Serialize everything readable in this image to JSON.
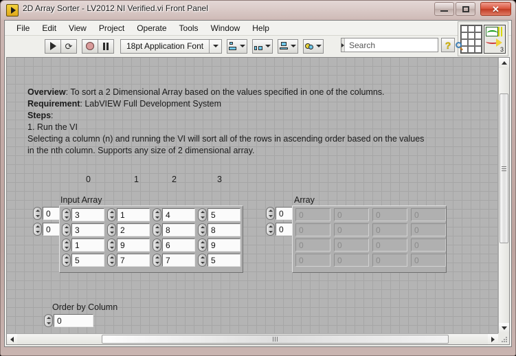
{
  "window": {
    "title": "2D Array Sorter - LV2012 NI Verified.vi Front Panel",
    "icon": "labview-vi-icon",
    "minimize_label": "–",
    "maximize_label": "□",
    "close_label": "✕"
  },
  "menu": {
    "items": [
      {
        "label": "File"
      },
      {
        "label": "Edit"
      },
      {
        "label": "View"
      },
      {
        "label": "Project"
      },
      {
        "label": "Operate"
      },
      {
        "label": "Tools"
      },
      {
        "label": "Window"
      },
      {
        "label": "Help"
      }
    ]
  },
  "toolbar": {
    "run_tooltip": "Run",
    "run_continuous_tooltip": "Run Continuously",
    "abort_tooltip": "Abort Execution",
    "pause_tooltip": "Pause",
    "font_selector": "18pt Application Font",
    "align_tooltip": "Align Objects",
    "distribute_tooltip": "Distribute Objects",
    "resize_tooltip": "Resize Objects",
    "reorder_tooltip": "Reorder",
    "run_continuous_glyph": "⟳"
  },
  "search": {
    "placeholder": "Search",
    "value": "",
    "icon": "magnifier-icon"
  },
  "help": {
    "label": "?"
  },
  "vi_icon": {
    "number": "3"
  },
  "description": {
    "overview_label": "Overview",
    "overview_text": ": To sort a 2 Dimensional Array based on the values specified in one of the columns.",
    "requirement_label": "Requirement",
    "requirement_text": ": LabVIEW Full Development System",
    "steps_label": "Steps",
    "steps_colon": ":",
    "step1": "1. Run the VI",
    "body": "Selecting a column (n) and running the VI will sort all of the rows in ascending order based on the values in the nth column. Supports any size of 2 dimensional array."
  },
  "column_headers": [
    "0",
    "1",
    "2",
    "3"
  ],
  "input_array": {
    "label": "Input Array",
    "row_index": "0",
    "col_index": "0",
    "rows": [
      [
        "3",
        "1",
        "4",
        "5"
      ],
      [
        "3",
        "2",
        "8",
        "8"
      ],
      [
        "1",
        "9",
        "6",
        "9"
      ],
      [
        "5",
        "7",
        "7",
        "5"
      ]
    ]
  },
  "output_array": {
    "label": "Array",
    "row_index": "0",
    "col_index": "0",
    "rows": [
      [
        "0",
        "0",
        "0",
        "0"
      ],
      [
        "0",
        "0",
        "0",
        "0"
      ],
      [
        "0",
        "0",
        "0",
        "0"
      ],
      [
        "0",
        "0",
        "0",
        "0"
      ]
    ]
  },
  "order_by_column": {
    "label": "Order by Column",
    "value": "0"
  },
  "colors": {
    "panel_background": "#b4b4b4",
    "panel_grid": "#a6a6a6",
    "chrome": "#efefeb",
    "close_button": "#d9543c",
    "title_frame": "#c3aaa6"
  }
}
